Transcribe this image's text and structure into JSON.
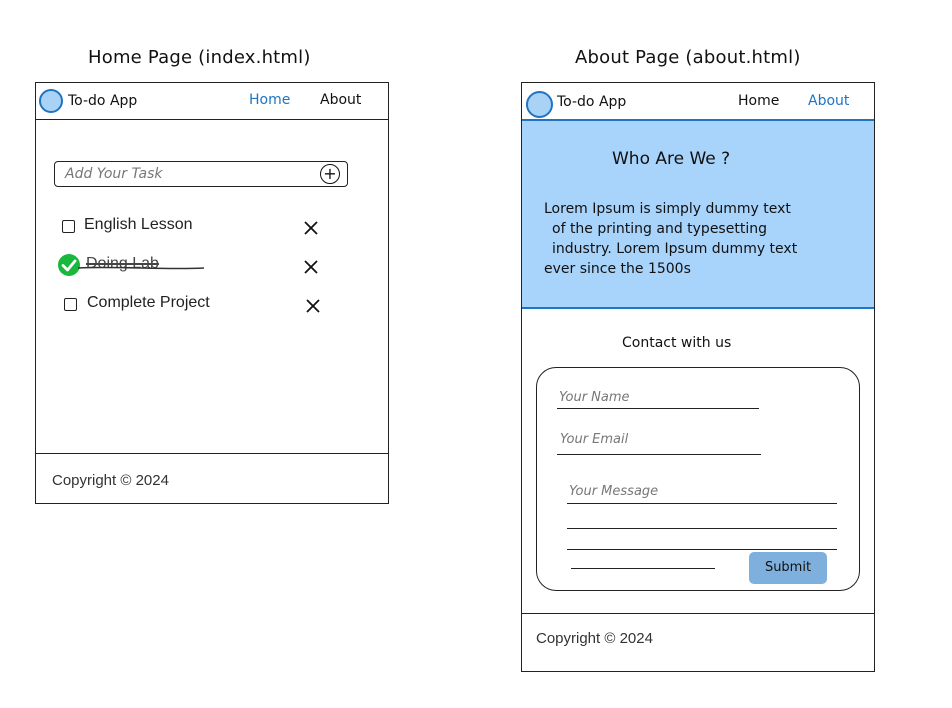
{
  "home": {
    "caption": "Home Page (index.html)",
    "app_title": "To-do App",
    "nav": {
      "home": "Home",
      "about": "About"
    },
    "add_placeholder": "Add Your Task",
    "add_icon": "+",
    "tasks": [
      {
        "label": "English Lesson",
        "done": false
      },
      {
        "label": "Doing Lab",
        "done": true
      },
      {
        "label": "Complete Project",
        "done": false
      }
    ],
    "footer": "Copyright © 2024"
  },
  "about": {
    "caption": "About Page (about.html)",
    "app_title": "To-do App",
    "nav": {
      "home": "Home",
      "about": "About"
    },
    "hero_title": "Who Are We ?",
    "hero_lines": [
      "Lorem Ipsum is simply dummy text",
      "of the printing and typesetting",
      "industry. Lorem Ipsum dummy text",
      "ever since the 1500s"
    ],
    "contact_title": "Contact with us",
    "name_placeholder": "Your Name",
    "email_placeholder": "Your Email",
    "message_placeholder": "Your Message",
    "submit_label": "Submit",
    "footer": "Copyright © 2024"
  },
  "colors": {
    "accent": "#1f74c4",
    "hero_bg": "#a8d3fa",
    "submit_bg": "#7fb0dd",
    "done_green": "#17b83c"
  }
}
